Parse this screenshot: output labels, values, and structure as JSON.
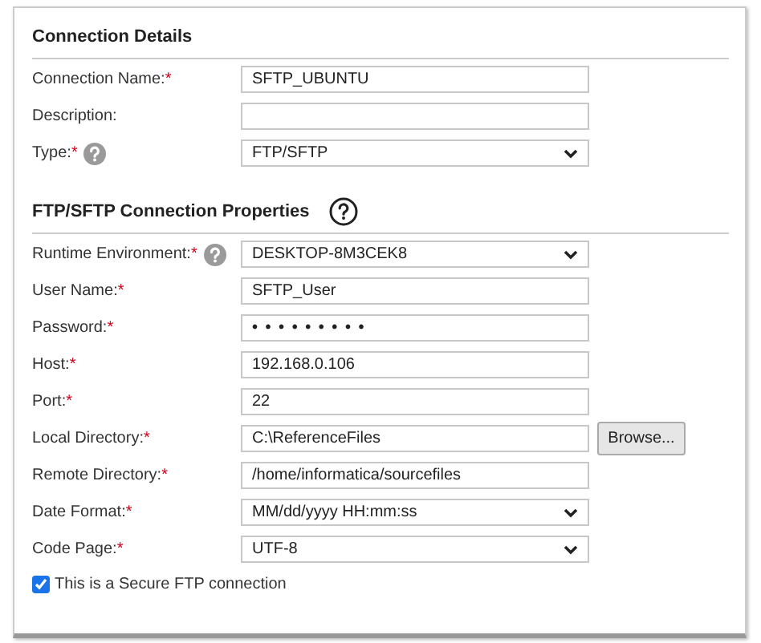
{
  "sections": [
    {
      "title": "Connection Details",
      "help": false,
      "fields": [
        {
          "label": "Connection Name:",
          "required_mark": "*",
          "help": false,
          "kind": "text",
          "value": "SFTP_UBUNTU"
        },
        {
          "label": "Description:",
          "help": false,
          "kind": "text"
        },
        {
          "label": "Type:",
          "required_mark": "*",
          "help": true,
          "kind": "select",
          "value": "FTP/SFTP"
        }
      ]
    },
    {
      "title": "FTP/SFTP Connection Properties",
      "help": true,
      "fields": [
        {
          "label": "Runtime Environment:",
          "required_mark": "*",
          "help": true,
          "kind": "select",
          "value": "DESKTOP-8M3CEK8"
        },
        {
          "label": "User Name:",
          "required_mark": "*",
          "help": false,
          "kind": "text",
          "value": "SFTP_User"
        },
        {
          "label": "Password:",
          "required_mark": "*",
          "help": false,
          "kind": "password",
          "value": "• • • • • • • • •"
        },
        {
          "label": "Host:",
          "required_mark": "*",
          "help": false,
          "kind": "text",
          "value": "192.168.0.106"
        },
        {
          "label": "Port:",
          "required_mark": "*",
          "help": false,
          "kind": "text",
          "value": "22"
        },
        {
          "label": "Local Directory:",
          "required_mark": "*",
          "help": false,
          "kind": "file",
          "value": "C:\\ReferenceFiles",
          "button": "Browse..."
        },
        {
          "label": "Remote Directory:",
          "required_mark": "*",
          "help": false,
          "kind": "text",
          "value": "/home/informatica/sourcefiles"
        },
        {
          "label": "Date Format:",
          "required_mark": "*",
          "help": false,
          "kind": "select",
          "value": "MM/dd/yyyy HH:mm:ss"
        },
        {
          "label": "Code Page:",
          "required_mark": "*",
          "help": false,
          "kind": "select",
          "value": "UTF-8"
        }
      ]
    }
  ],
  "secure_checkbox": {
    "label": "This is a Secure FTP connection",
    "checked": true
  }
}
